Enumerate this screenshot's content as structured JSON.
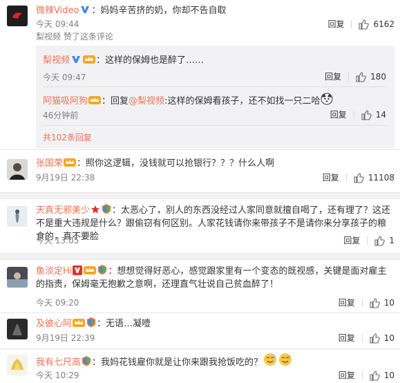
{
  "comments": [
    {
      "name": "微辣Video",
      "text": "妈妈辛苦挤的奶，你却不告自取",
      "time": "今天 09:44",
      "liked_note": "梨视频 赞了这条评论",
      "reply": "回复",
      "likes": "6162"
    },
    {
      "name": "张国荣",
      "text": "照你这逻辑，没钱就可以抢银行？？？什么人啊",
      "time": "9月19日 22:38",
      "reply": "回复",
      "likes": "11108"
    },
    {
      "name": "天真无邪美少",
      "text": "太恶心了，别人的东西没经过人家同意就擅自喝了，还有理了？这还不是重大违规是什么？跟偷窃有何区别。人家花钱请你来带孩子不是请你来分享孩子的粮食的，真不要脸",
      "time": "今天 13:05",
      "reply": "回复",
      "likes": "1"
    },
    {
      "name": "鱼淡定Hi",
      "text": "想想觉得好恶心，感觉跟家里有一个变态的既视感，关键是面对雇主的指责，保姆毫无抱歉之意啊，还理直气壮说自己贫血醉了！",
      "time": "今天 09:20",
      "reply": "回复",
      "likes": "10"
    },
    {
      "name": "及彼心阿",
      "text": "无语…凝噎",
      "time": "9月19日 22:39",
      "reply": "回复",
      "likes": "10"
    },
    {
      "name": "我有七尺高",
      "text": "我妈花钱雇你就是让你来跟我抢饭吃的？",
      "time": "今天 10:29",
      "reply": "回复",
      "likes": "10"
    }
  ],
  "sub_replies": [
    {
      "name": "梨视频",
      "text": "这样的保姆也是醉了……",
      "time": "今天 09:47",
      "reply": "回复",
      "likes": "180"
    },
    {
      "name": "阿猫吸阿狗",
      "prefix": "回复",
      "mention": "@梨视频",
      "text": "这样的保姆看孩子，还不如找一只二哈",
      "time": "46分钟前",
      "reply": "回复",
      "likes": "14"
    }
  ],
  "more_replies": "共102条回复",
  "colors": {
    "name": "#eb7350",
    "verified": "#f6a623",
    "muted": "#808080"
  }
}
